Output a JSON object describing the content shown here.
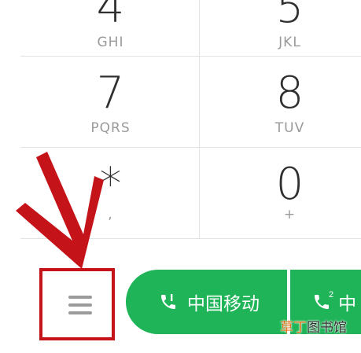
{
  "keypad": {
    "keys": [
      {
        "digit": "4",
        "letters": "GHI"
      },
      {
        "digit": "5",
        "letters": "JKL"
      },
      {
        "digit": "7",
        "letters": "PQRS"
      },
      {
        "digit": "8",
        "letters": "TUV"
      },
      {
        "digit": "*",
        "letters": ","
      },
      {
        "digit": "0",
        "letters": "+"
      }
    ]
  },
  "bottom_bar": {
    "menu_icon": "hamburger-menu-icon",
    "sim1_label": "中国移动",
    "sim1_icon": "phone-sim1-icon",
    "sim2_label": "中",
    "sim2_icon": "phone-sim2-icon",
    "sim2_number": "2",
    "call_color": "#1eb457"
  },
  "annotation": {
    "arrow_color": "#c4141a",
    "box_color": "#c4141a"
  },
  "watermark": {
    "part1": "草丁",
    "part2": "图书馆"
  }
}
